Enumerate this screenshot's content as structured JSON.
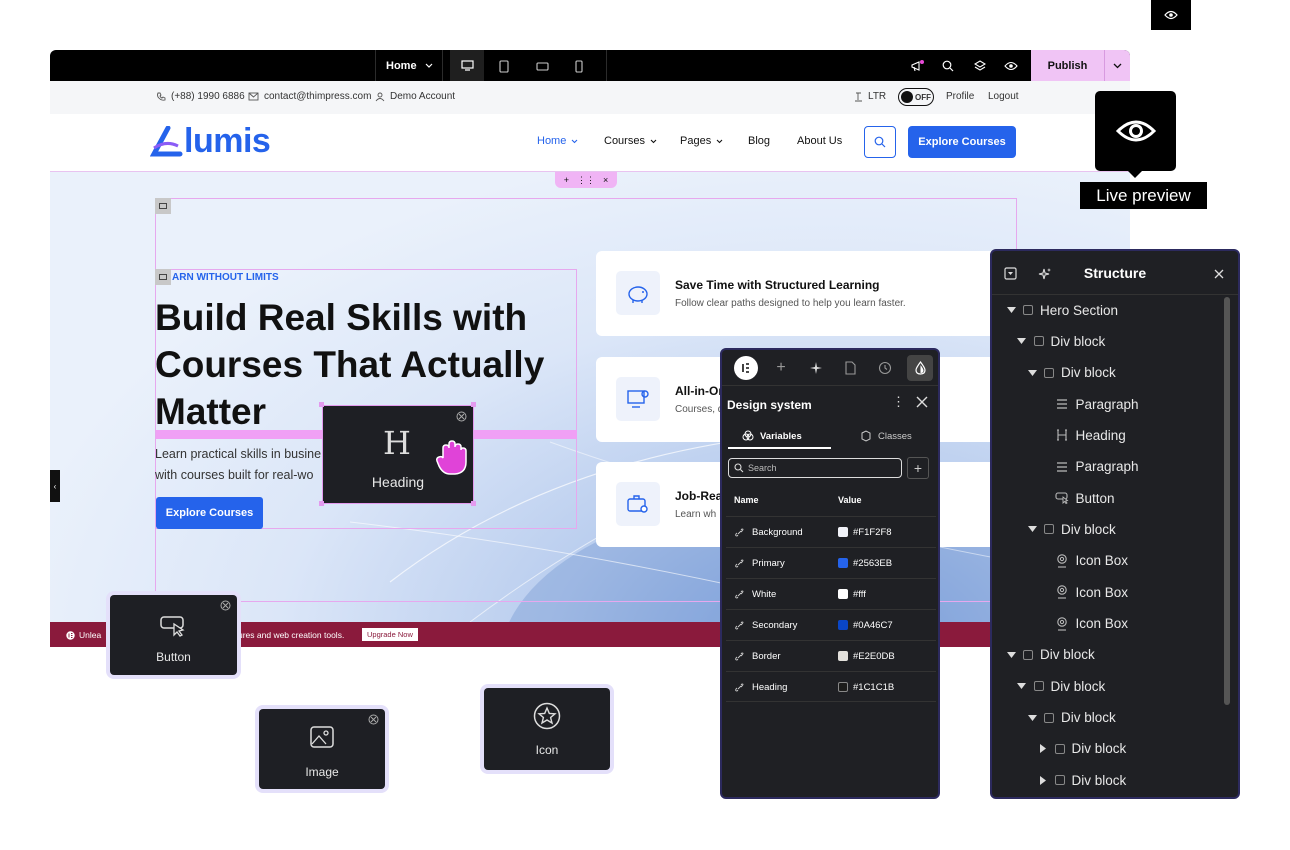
{
  "topbar": {
    "page": "Home",
    "publish": "Publish"
  },
  "infobar": {
    "phone": "(+88) 1990 6886",
    "email": "contact@thimpress.com",
    "account": "Demo Account",
    "direction": "LTR",
    "toggle": "OFF",
    "profile": "Profile",
    "logout": "Logout"
  },
  "nav": {
    "logo": "lumis",
    "links": [
      "Home",
      "Courses",
      "Pages",
      "Blog",
      "About Us"
    ],
    "cta": "Explore Courses"
  },
  "hero": {
    "eyebrow": "ARN WITHOUT LIMITS",
    "title": "Build Real Skills with Courses That Actually Matter",
    "desc_line1": "Learn practical skills in busine",
    "desc_line2": "with courses built for real-wo",
    "cta": "Explore Courses",
    "cards": [
      {
        "title": "Save Time with Structured Learning",
        "desc": "Follow clear paths designed to help you learn faster."
      },
      {
        "title": "All-in-On",
        "desc": "Courses, q"
      },
      {
        "title": "Job-Rea",
        "desc": "Learn wh"
      }
    ]
  },
  "promo": {
    "left": "Unlea",
    "right": "ures and web creation tools.",
    "button": "Upgrade Now"
  },
  "live_preview": "Live preview",
  "widgets": {
    "heading": "Heading",
    "button": "Button",
    "image": "Image",
    "icon": "Icon"
  },
  "design_system": {
    "title": "Design system",
    "tab_variables": "Variables",
    "tab_classes": "Classes",
    "search_placeholder": "Search",
    "col_name": "Name",
    "col_value": "Value",
    "rows": [
      {
        "name": "Background",
        "value": "#F1F2F8",
        "color": "#F1F2F8"
      },
      {
        "name": "Primary",
        "value": "#2563EB",
        "color": "#2563EB"
      },
      {
        "name": "White",
        "value": "#fff",
        "color": "#ffffff"
      },
      {
        "name": "Secondary",
        "value": "#0A46C7",
        "color": "#0A46C7"
      },
      {
        "name": "Border",
        "value": "#E2E0DB",
        "color": "#E2E0DB"
      },
      {
        "name": "Heading",
        "value": "#1C1C1B",
        "color": "#1C1C1B"
      }
    ]
  },
  "structure": {
    "title": "Structure",
    "items": [
      {
        "label": "Hero Section",
        "icon": "box",
        "caret": "down"
      },
      {
        "label": "Div block",
        "icon": "box",
        "caret": "down"
      },
      {
        "label": "Div block",
        "icon": "box",
        "caret": "down"
      },
      {
        "label": "Paragraph",
        "icon": "paragraph",
        "caret": "none"
      },
      {
        "label": "Heading",
        "icon": "heading",
        "caret": "none"
      },
      {
        "label": "Paragraph",
        "icon": "paragraph",
        "caret": "none"
      },
      {
        "label": "Button",
        "icon": "button",
        "caret": "none"
      },
      {
        "label": "Div block",
        "icon": "box",
        "caret": "down"
      },
      {
        "label": "Icon Box",
        "icon": "iconbox",
        "caret": "none"
      },
      {
        "label": "Icon Box",
        "icon": "iconbox",
        "caret": "none"
      },
      {
        "label": "Icon Box",
        "icon": "iconbox",
        "caret": "none"
      },
      {
        "label": "Div block",
        "icon": "box",
        "caret": "down"
      },
      {
        "label": "Div block",
        "icon": "box",
        "caret": "down"
      },
      {
        "label": "Div block",
        "icon": "box",
        "caret": "down"
      },
      {
        "label": "Div block",
        "icon": "box",
        "caret": "right"
      },
      {
        "label": "Div block",
        "icon": "box",
        "caret": "right"
      }
    ]
  }
}
